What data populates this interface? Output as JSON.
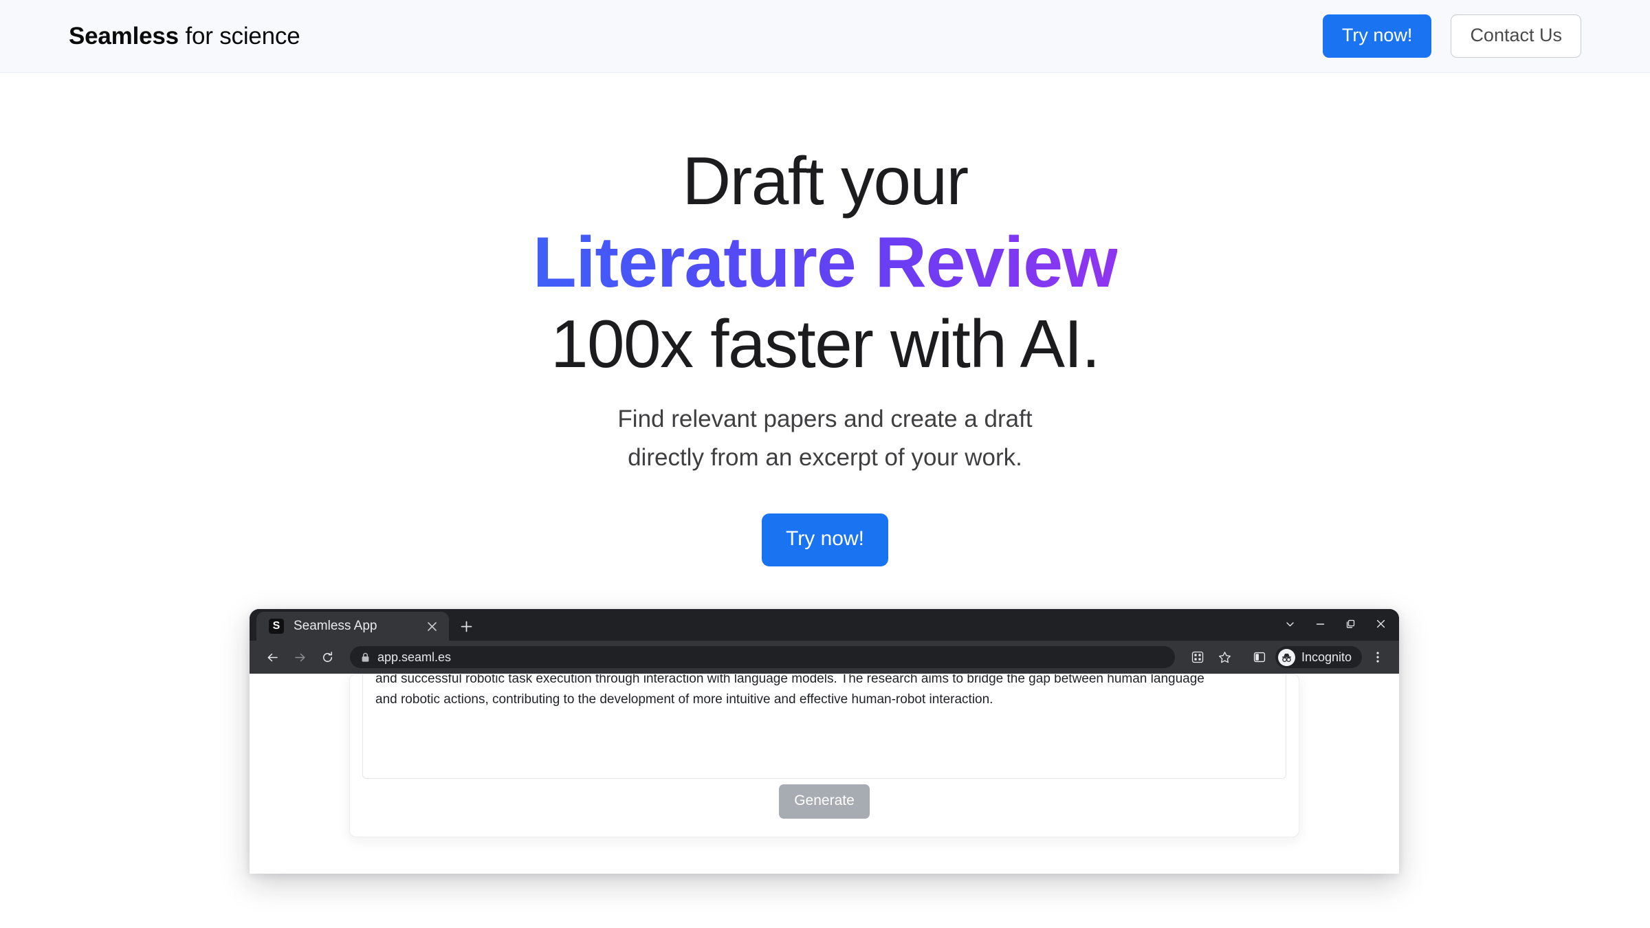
{
  "header": {
    "brand_strong": "Seamless",
    "brand_light": " for science",
    "try_now_label": "Try now!",
    "contact_label": "Contact Us",
    "accent_color": "#1a73f0"
  },
  "hero": {
    "line1": "Draft your",
    "line2_accent": "Literature Review",
    "line3": "100x faster with AI.",
    "sub_line1": "Find relevant papers and create a draft",
    "sub_line2": "directly from an excerpt of your work.",
    "cta_label": "Try now!",
    "gradient_start": "#3f5ff8",
    "gradient_end": "#8f35f0"
  },
  "browser_mockup": {
    "tab": {
      "favicon_letter": "S",
      "title": "Seamless App",
      "close_icon": "close-icon",
      "new_tab_icon": "plus-icon"
    },
    "window_controls": [
      {
        "name": "chevron-down-icon",
        "glyph": "⌄"
      },
      {
        "name": "minimize-icon",
        "glyph": "–"
      },
      {
        "name": "maximize-icon",
        "glyph": "❐"
      },
      {
        "name": "close-icon",
        "glyph": "✕"
      }
    ],
    "toolbar": {
      "back_icon": "back-arrow-icon",
      "forward_icon": "forward-arrow-icon",
      "reload_icon": "reload-icon",
      "lock_icon": "lock-icon",
      "url": "app.seaml.es",
      "extensions_icon": "extensions-grid-icon",
      "bookmark_icon": "star-icon",
      "side_panel_icon": "side-panel-icon",
      "profile_name": "Incognito",
      "profile_avatar_icon": "incognito-avatar-icon",
      "menu_icon": "three-dot-menu-icon"
    },
    "app": {
      "excerpt_line1": "and successful robotic task execution through interaction with language models. The research aims to bridge the gap between human language",
      "excerpt_line2": "and robotic actions, contributing to the development of more intuitive and effective human-robot interaction.",
      "generate_label": "Generate",
      "generate_disabled_color": "#a7acb3"
    }
  }
}
